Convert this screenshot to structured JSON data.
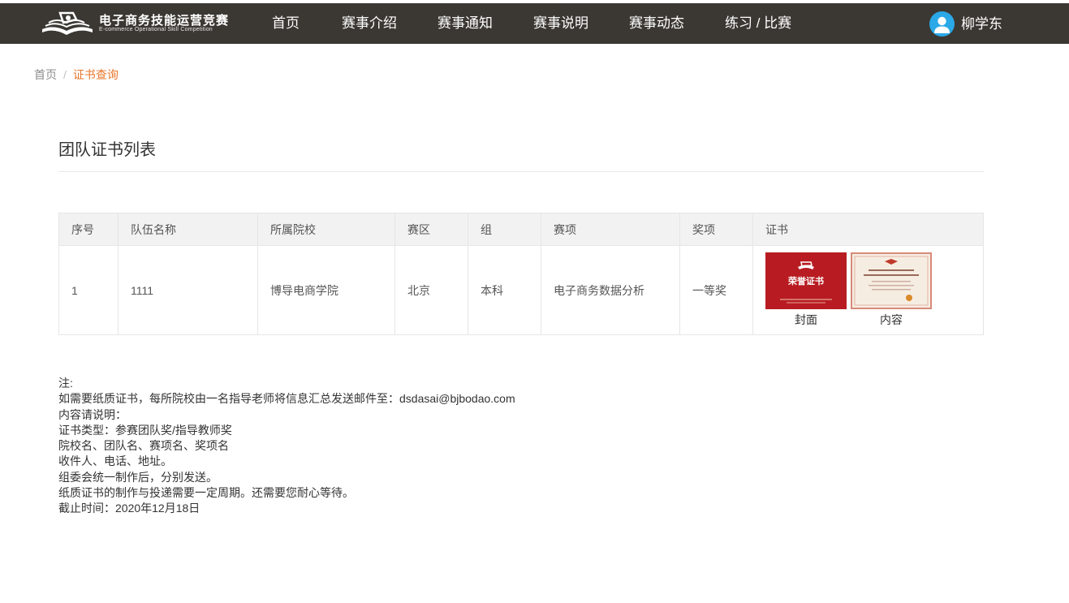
{
  "header": {
    "logo_title": "电子商务技能运营竞赛",
    "logo_subtitle": "E-commerce Operational Skill Competition",
    "nav": [
      {
        "label": "首页"
      },
      {
        "label": "赛事介绍"
      },
      {
        "label": "赛事通知"
      },
      {
        "label": "赛事说明"
      },
      {
        "label": "赛事动态"
      },
      {
        "label": "练习 / 比赛"
      }
    ],
    "user_name": "柳学东",
    "colors": {
      "bar": "#3b3833",
      "avatar": "#2aa8e8"
    }
  },
  "breadcrumb": {
    "home": "首页",
    "separator": "/",
    "current": "证书查询",
    "accent": "#e8762b"
  },
  "section_title": "团队证书列表",
  "table": {
    "columns": [
      "序号",
      "队伍名称",
      "所属院校",
      "赛区",
      "组",
      "赛项",
      "奖项",
      "证书"
    ],
    "rows": [
      {
        "index": "1",
        "team": "1111",
        "school": "博导电商学院",
        "region": "北京",
        "group": "本科",
        "event": "电子商务数据分析",
        "award": "一等奖",
        "certificate": {
          "cover_label": "封面",
          "content_label": "内容",
          "cover_text": "荣誉证书"
        }
      }
    ]
  },
  "notes": {
    "lines": [
      "注:",
      "如需要纸质证书，每所院校由一名指导老师将信息汇总发送邮件至：dsdasai@bjbodao.com",
      "内容请说明：",
      "证书类型：参赛团队奖/指导教师奖",
      "院校名、团队名、赛项名、奖项名",
      "收件人、电话、地址。",
      "组委会统一制作后，分别发送。",
      "纸质证书的制作与投递需要一定周期。还需要您耐心等待。",
      "截止时间：2020年12月18日"
    ]
  }
}
